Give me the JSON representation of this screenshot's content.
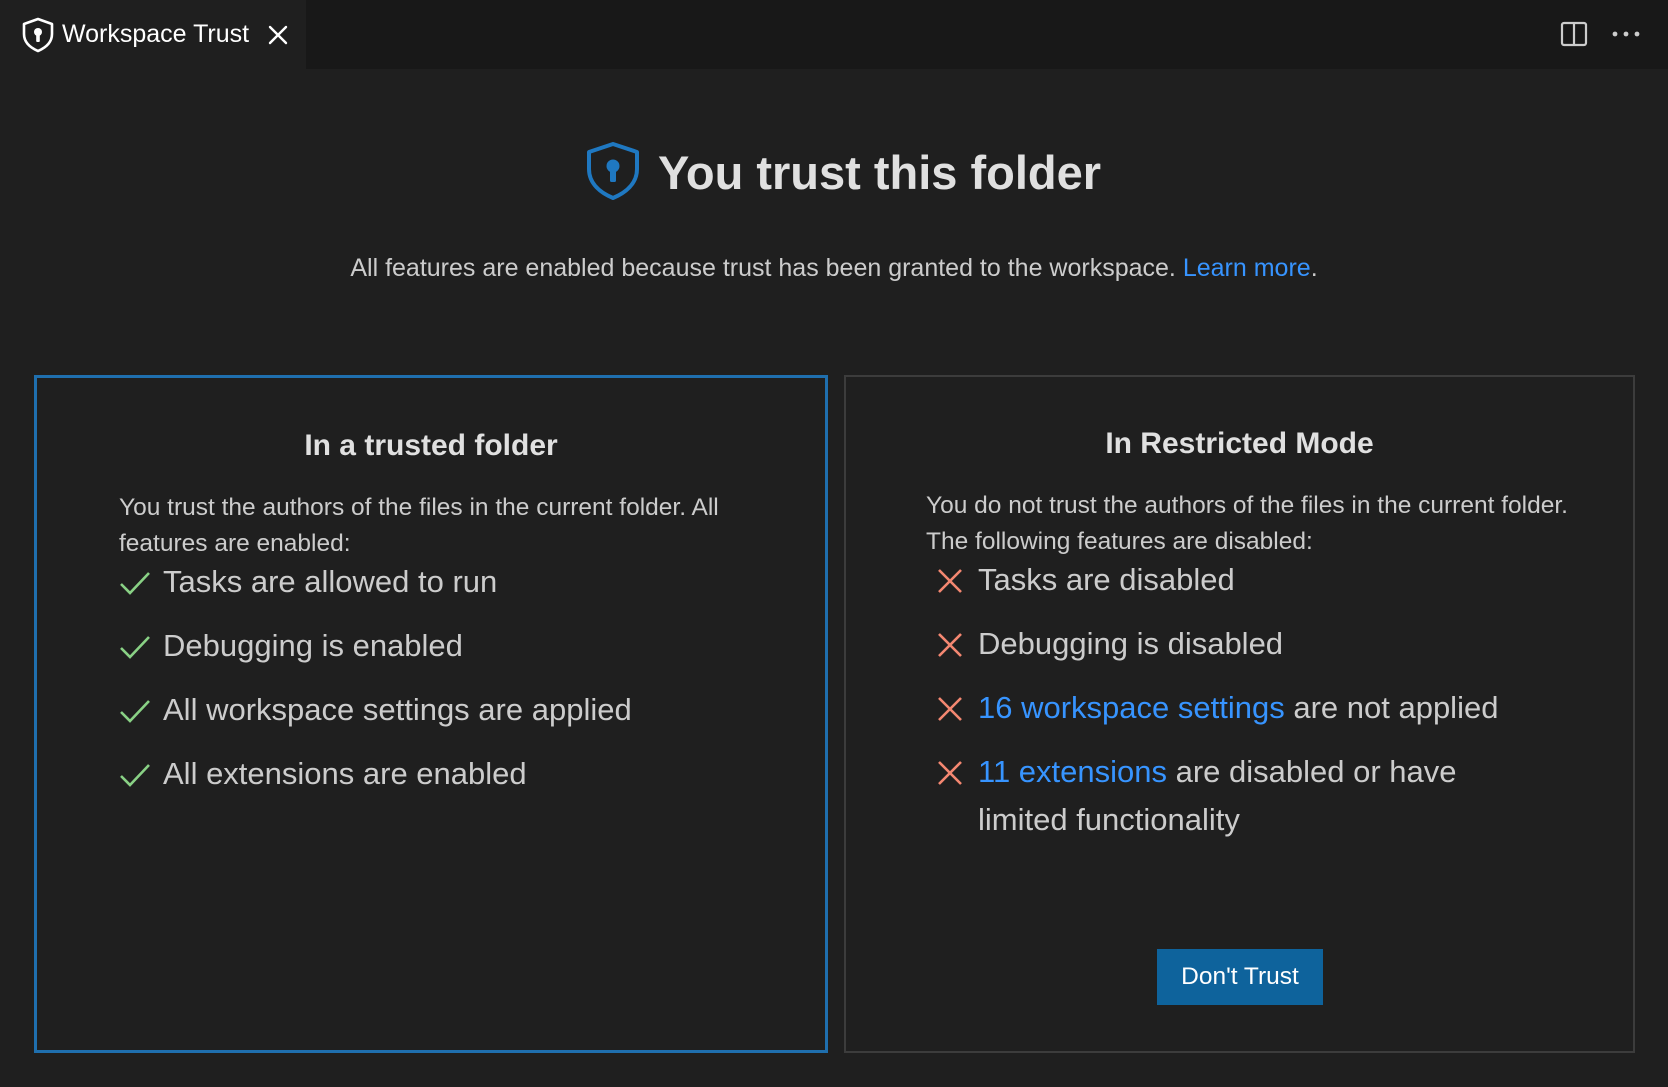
{
  "tab": {
    "title": "Workspace Trust",
    "icon": "shield-lock-icon"
  },
  "editor_actions": {
    "split_icon": "split-editor-icon",
    "more_icon": "more-actions-icon"
  },
  "header": {
    "title": "You trust this folder",
    "subtitle_text": "All features are enabled because trust has been granted to the workspace. ",
    "learn_more": "Learn more",
    "subtitle_end": "."
  },
  "trusted_card": {
    "title": "In a trusted folder",
    "description": "You trust the authors of the files in the current folder. All features are enabled:",
    "features": [
      "Tasks are allowed to run",
      "Debugging is enabled",
      "All workspace settings are applied",
      "All extensions are enabled"
    ]
  },
  "restricted_card": {
    "title": "In Restricted Mode",
    "description": "You do not trust the authors of the files in the current folder. The following features are disabled:",
    "features": {
      "tasks": "Tasks are disabled",
      "debugging": "Debugging is disabled",
      "settings_link": "16 workspace settings",
      "settings_rest": " are not applied",
      "extensions_link": "11 extensions",
      "extensions_rest": " are disabled or have limited functionality"
    },
    "button_label": "Don't Trust"
  },
  "colors": {
    "background": "#1f1f1f",
    "tabbar": "#181818",
    "accent_border": "#1f6fae",
    "link": "#3794ff",
    "check": "#89d185",
    "cross": "#f48771",
    "button": "#0e639c"
  }
}
